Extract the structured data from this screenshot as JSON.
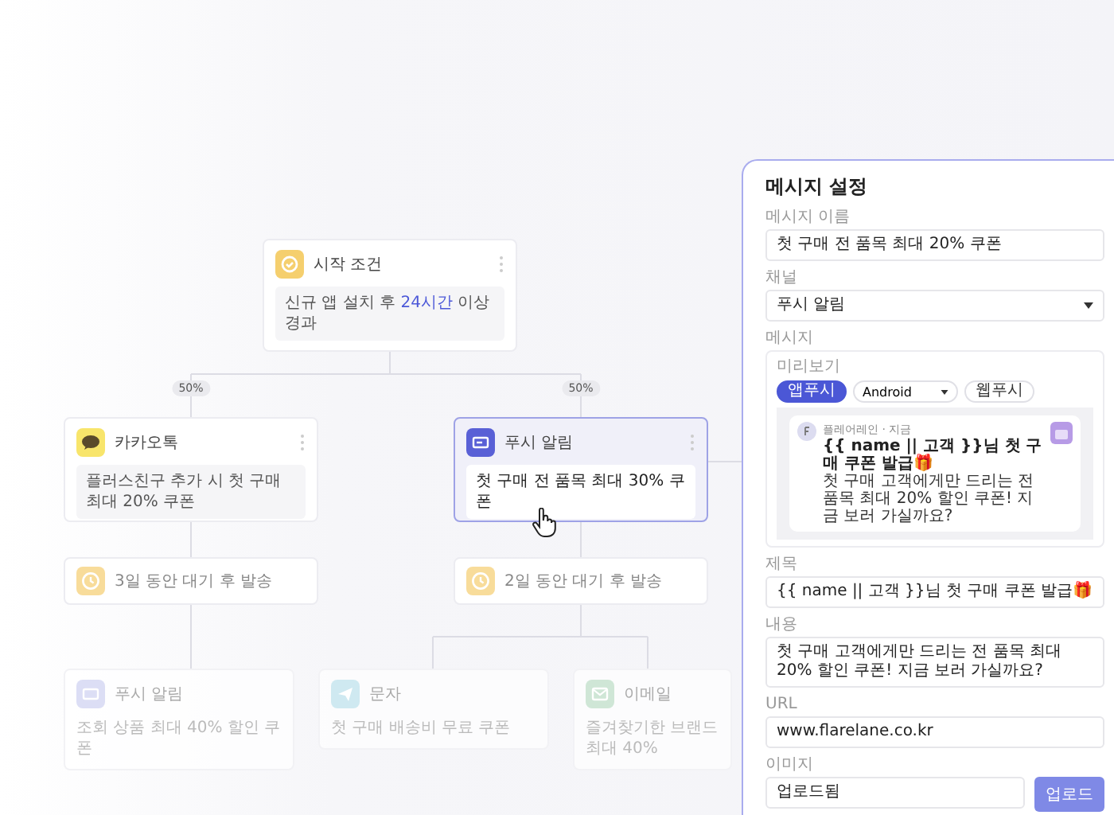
{
  "start_node": {
    "title": "시작 조건",
    "condition": {
      "before": "신규 앱 설치 후",
      "highlight": "24시간",
      "after": "이상 경과"
    }
  },
  "branch_labels": [
    "50%",
    "50%"
  ],
  "branches": [
    {
      "message": {
        "kind": "kakao",
        "title": "카카오톡",
        "body": "플러스친구 추가 시 첫 구매 최대 20% 쿠폰",
        "selected": false
      },
      "wait": "3일 동안 대기 후 발송"
    },
    {
      "message": {
        "kind": "push",
        "title": "푸시 알림",
        "body": "첫 구매 전 품목 최대 30% 쿠폰",
        "selected": true
      },
      "wait": "2일 동안 대기 후 발송"
    }
  ],
  "next_nodes": [
    {
      "kind": "push",
      "title": "푸시 알림",
      "body": "조회 상품 최대 40% 할인 쿠폰"
    },
    {
      "kind": "sms",
      "title": "문자",
      "body": "첫 구매 배송비 무료 쿠폰"
    },
    {
      "kind": "email",
      "title": "이메일",
      "body": "즐겨찾기한 브랜드 최대 40%"
    }
  ],
  "panel": {
    "title": "메시지 설정",
    "name_field": {
      "label": "메시지 이름",
      "value": "첫 구매 전 품목 최대 20% 쿠폰"
    },
    "channel_field": {
      "label": "채널",
      "value": "푸시 알림"
    },
    "message_label": "메시지",
    "preview": {
      "label": "미리보기",
      "platform_tabs": [
        {
          "label": "앱푸시",
          "selected": true
        },
        {
          "label": "웹푸시",
          "selected": false
        }
      ],
      "os_select": "Android",
      "notification": {
        "app": "플레어레인 · 지금",
        "title": "{{ name || 고객 }}님 첫 구매 쿠폰 발급🎁",
        "body": "첫 구매 고객에게만 드리는 전 품목 최대 20% 할인 쿠폰! 지금 보러 가실까요?"
      }
    },
    "fields": [
      {
        "kind": "text",
        "label": "제목",
        "value": "{{ name || 고객 }}님 첫 구매 쿠폰 발급🎁"
      },
      {
        "kind": "textarea",
        "label": "내용",
        "value": "첫 구매 고객에게만 드리는 전 품목 최대 20% 할인 쿠폰! 지금 보러 가실까요?"
      },
      {
        "kind": "text",
        "label": "URL",
        "value": "www.flarelane.co.kr"
      },
      {
        "kind": "upload",
        "label": "이미지",
        "value": "업로드됨",
        "button": "업로드"
      }
    ]
  }
}
